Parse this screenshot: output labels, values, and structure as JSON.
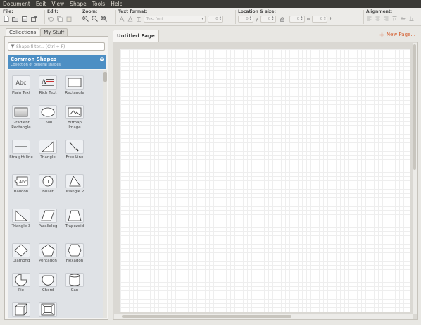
{
  "menu": [
    "Document",
    "Edit",
    "View",
    "Shape",
    "Tools",
    "Help"
  ],
  "toolbar": {
    "file_label": "File:",
    "edit_label": "Edit:",
    "zoom_label": "Zoom:",
    "text_format_label": "Text format:",
    "font_placeholder": "Text font",
    "font_size": "0",
    "location_label": "Location & size:",
    "x_value": "0",
    "y_label": "y",
    "y_value": "0",
    "w_label": "w",
    "w_value": "0",
    "h_label": "h",
    "h_value": "0",
    "alignment_label": "Alignment:"
  },
  "sidebar": {
    "tabs": [
      "Collections",
      "My Stuff"
    ],
    "filter_placeholder": "Shape filter... (Ctrl + F)",
    "collection": {
      "title": "Common Shapes",
      "description": "Collection of general shapes"
    },
    "shapes": [
      {
        "name": "Plain Text",
        "icon": "plain-text-icon",
        "preview": "Abc"
      },
      {
        "name": "Rich Text",
        "icon": "rich-text-icon"
      },
      {
        "name": "Rectangle",
        "icon": "rectangle-icon"
      },
      {
        "name": "Gradient Rectangle",
        "icon": "gradient-rectangle-icon"
      },
      {
        "name": "Oval",
        "icon": "oval-icon"
      },
      {
        "name": "Bitmap Image",
        "icon": "bitmap-image-icon"
      },
      {
        "name": "Straight line",
        "icon": "straight-line-icon"
      },
      {
        "name": "Triangle",
        "icon": "triangle-icon"
      },
      {
        "name": "Free Line",
        "icon": "free-line-icon"
      },
      {
        "name": "Balloon",
        "icon": "balloon-icon",
        "preview": "Abc"
      },
      {
        "name": "Bullet",
        "icon": "bullet-icon",
        "preview": "1"
      },
      {
        "name": "Triangle 2",
        "icon": "triangle-2-icon"
      },
      {
        "name": "Triangle 3",
        "icon": "triangle-3-icon"
      },
      {
        "name": "Parallelog",
        "icon": "parallelogram-icon"
      },
      {
        "name": "Trapezoid",
        "icon": "trapezoid-icon"
      },
      {
        "name": "Diamond",
        "icon": "diamond-icon"
      },
      {
        "name": "Pentagon",
        "icon": "pentagon-icon"
      },
      {
        "name": "Hexagon",
        "icon": "hexagon-icon"
      },
      {
        "name": "Pie",
        "icon": "pie-icon"
      },
      {
        "name": "Chord",
        "icon": "chord-icon"
      },
      {
        "name": "Can",
        "icon": "can-icon"
      },
      {
        "name": "",
        "icon": "cube-icon"
      },
      {
        "name": "",
        "icon": "frame-icon"
      }
    ]
  },
  "document": {
    "page_tab": "Untitled Page",
    "new_page": "New Page..."
  },
  "colors": {
    "menubar_bg": "#3b3a36",
    "collection_header_bg": "#4d8fc4",
    "new_page_accent": "#d45a2a",
    "shape_list_bg": "#dfe2e6"
  }
}
